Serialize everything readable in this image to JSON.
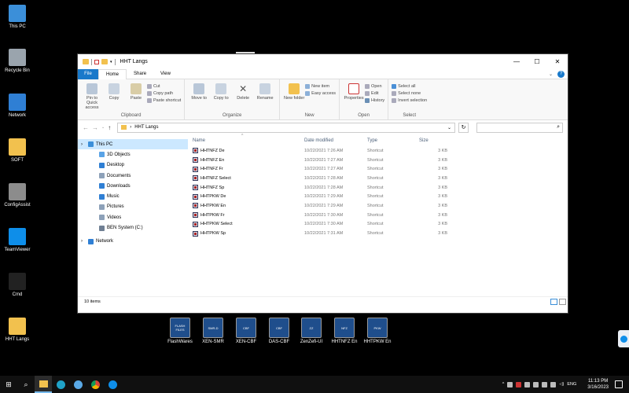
{
  "desktop": {
    "icons": [
      {
        "label": "This PC",
        "color": "#3b8fd9"
      },
      {
        "label": "Recycle Bin",
        "color": "#9aa4ad"
      },
      {
        "label": "Network",
        "color": "#2f7fd4"
      },
      {
        "label": "SOFT",
        "color": "#f2c14e"
      },
      {
        "label": "ConfigAssist",
        "color": "#8c8c8c"
      },
      {
        "label": "TeamViewer",
        "color": "#0e8ee9"
      },
      {
        "label": "Cmd",
        "color": "#222222"
      },
      {
        "label": "HHT Langs",
        "color": "#f2c14e"
      }
    ],
    "shortcuts": [
      {
        "label": "FlashWares",
        "badge": "FLASH FILES"
      },
      {
        "label": "XEN-SMR",
        "badge": "SMR-D"
      },
      {
        "label": "XEN-CBF",
        "badge": "CBF"
      },
      {
        "label": "DAS-CBF",
        "badge": "CBF"
      },
      {
        "label": "ZenZefi-UI",
        "badge": "ZZ"
      },
      {
        "label": "HHTNFZ En",
        "badge": "NFZ"
      },
      {
        "label": "HHTPKW En",
        "badge": "PKW"
      }
    ]
  },
  "window": {
    "title": "HHT Langs",
    "controls": {
      "minimize": "—",
      "maximize": "☐",
      "close": "✕"
    },
    "tabs": {
      "file": "File",
      "home": "Home",
      "share": "Share",
      "view": "View"
    },
    "help": "?",
    "ribbon": {
      "clipboard": {
        "name": "Clipboard",
        "pin": "Pin to Quick access",
        "copy": "Copy",
        "paste": "Paste",
        "cut": "Cut",
        "copy_path": "Copy path",
        "paste_shortcut": "Paste shortcut"
      },
      "organize": {
        "name": "Organize",
        "move_to": "Move to",
        "copy_to": "Copy to",
        "delete": "Delete",
        "rename": "Rename"
      },
      "new": {
        "name": "New",
        "new_folder": "New folder",
        "new_item": "New item",
        "easy_access": "Easy access"
      },
      "open": {
        "name": "Open",
        "properties": "Properties",
        "open": "Open",
        "edit": "Edit",
        "history": "History"
      },
      "select": {
        "name": "Select",
        "select_all": "Select all",
        "select_none": "Select none",
        "invert": "Invert selection"
      }
    },
    "address": {
      "path": "HHT Langs",
      "search_placeholder": ""
    },
    "navpane": [
      {
        "label": "This PC",
        "color": "#3b8fd9",
        "selected": true
      },
      {
        "label": "3D Objects",
        "color": "#5aa3e6"
      },
      {
        "label": "Desktop",
        "color": "#2f7fd4"
      },
      {
        "label": "Documents",
        "color": "#8da1b9"
      },
      {
        "label": "Downloads",
        "color": "#2f7fd4"
      },
      {
        "label": "Music",
        "color": "#2f7fd4"
      },
      {
        "label": "Pictures",
        "color": "#8da1b9"
      },
      {
        "label": "Videos",
        "color": "#8da1b9"
      },
      {
        "label": "BEN System (C:)",
        "color": "#6f7f93"
      },
      {
        "label": "Network",
        "color": "#2f7fd4"
      }
    ],
    "columns": {
      "name": "Name",
      "date": "Date modified",
      "type": "Type",
      "size": "Size"
    },
    "files": [
      {
        "name": "HHTNFZ De",
        "date": "10/22/2021 7:26 AM",
        "type": "Shortcut",
        "size": "3 KB"
      },
      {
        "name": "HHTNFZ En",
        "date": "10/22/2021 7:27 AM",
        "type": "Shortcut",
        "size": "3 KB"
      },
      {
        "name": "HHTNFZ Fr",
        "date": "10/22/2021 7:27 AM",
        "type": "Shortcut",
        "size": "3 KB"
      },
      {
        "name": "HHTNFZ Select",
        "date": "10/22/2021 7:28 AM",
        "type": "Shortcut",
        "size": "3 KB"
      },
      {
        "name": "HHTNFZ Sp",
        "date": "10/22/2021 7:28 AM",
        "type": "Shortcut",
        "size": "3 KB"
      },
      {
        "name": "HHTPKW De",
        "date": "10/22/2021 7:29 AM",
        "type": "Shortcut",
        "size": "3 KB"
      },
      {
        "name": "HHTPKW En",
        "date": "10/22/2021 7:29 AM",
        "type": "Shortcut",
        "size": "3 KB"
      },
      {
        "name": "HHTPKW Fr",
        "date": "10/22/2021 7:30 AM",
        "type": "Shortcut",
        "size": "3 KB"
      },
      {
        "name": "HHTPKW Select",
        "date": "10/22/2021 7:30 AM",
        "type": "Shortcut",
        "size": "3 KB"
      },
      {
        "name": "HHTPKW Sp",
        "date": "10/22/2021 7:31 AM",
        "type": "Shortcut",
        "size": "3 KB"
      }
    ],
    "status": "10 items"
  },
  "taskbar": {
    "lang": "ENG",
    "time": "11:13 PM",
    "date": "3/16/2023"
  }
}
